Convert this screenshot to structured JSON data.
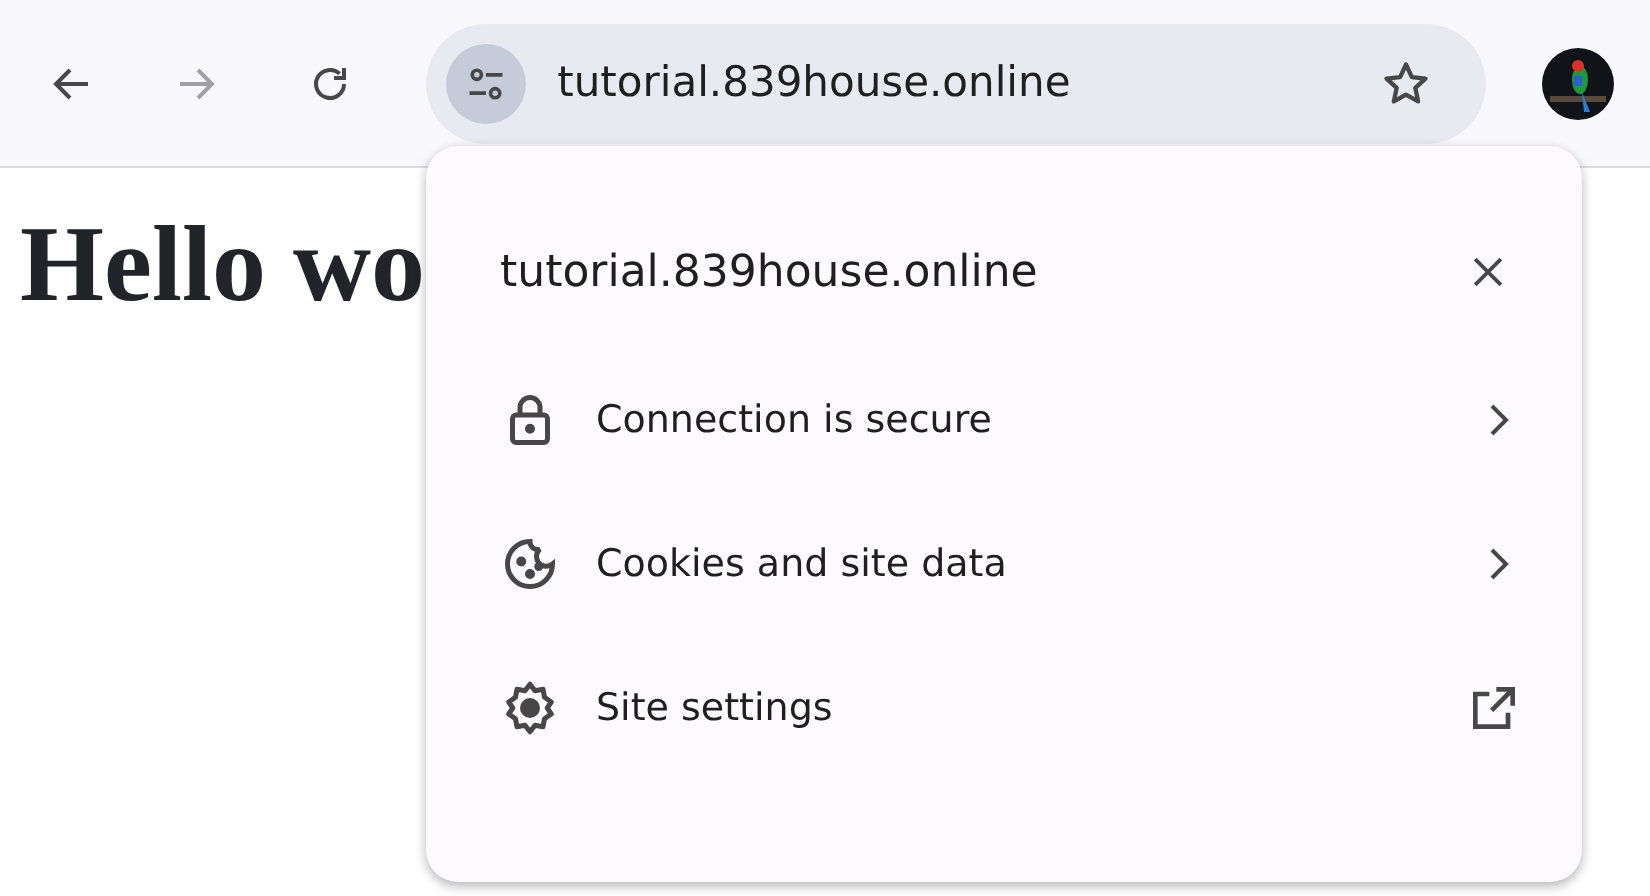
{
  "toolbar": {
    "back": {
      "disabled": false
    },
    "forward": {
      "disabled": true
    },
    "url": "tutorial.839house.online",
    "bookmarked": false
  },
  "page": {
    "heading": "Hello wo"
  },
  "site_popup": {
    "title": "tutorial.839house.online",
    "items": [
      {
        "kind": "lock",
        "label": "Connection is secure",
        "external": false
      },
      {
        "kind": "cookie",
        "label": "Cookies and site data",
        "external": false
      },
      {
        "kind": "gear",
        "label": "Site settings",
        "external": true
      }
    ]
  }
}
